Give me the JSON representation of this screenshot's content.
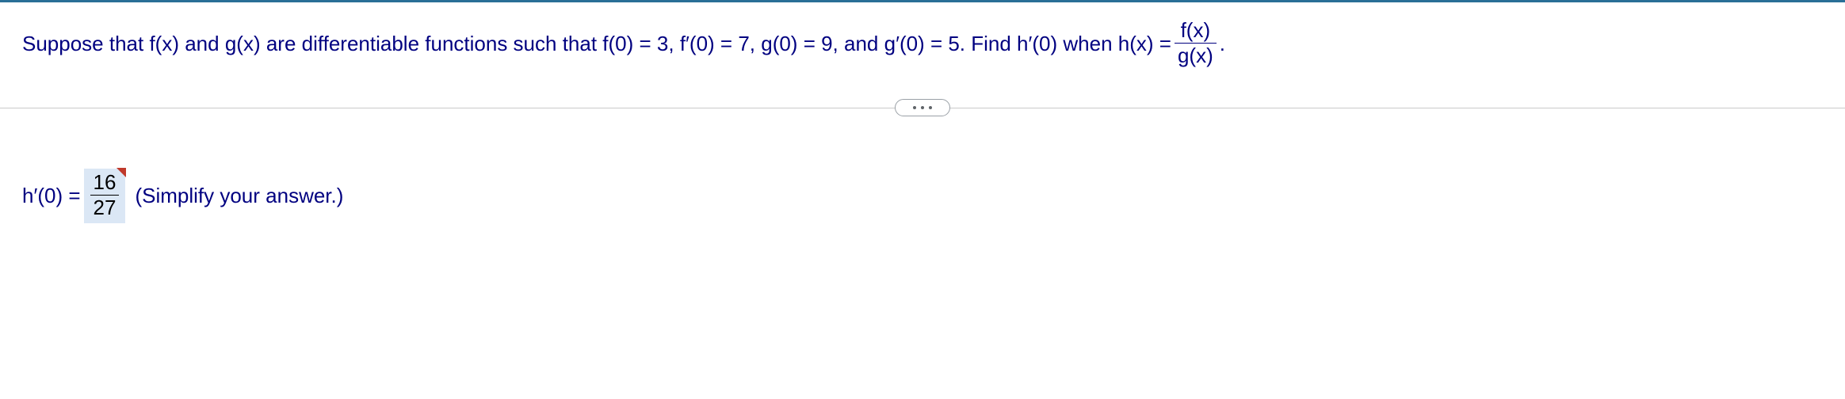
{
  "problem": {
    "text_before_fraction": "Suppose that f(x) and g(x) are differentiable functions such that f(0) = 3, f′(0) = 7, g(0) = 9, and g′(0) = 5. Find h′(0) when h(x) = ",
    "fraction_num": "f(x)",
    "fraction_den": "g(x)",
    "text_after_fraction": "."
  },
  "answer": {
    "lhs": "h′(0) = ",
    "value_num": "16",
    "value_den": "27",
    "hint": " (Simplify your answer.)"
  }
}
